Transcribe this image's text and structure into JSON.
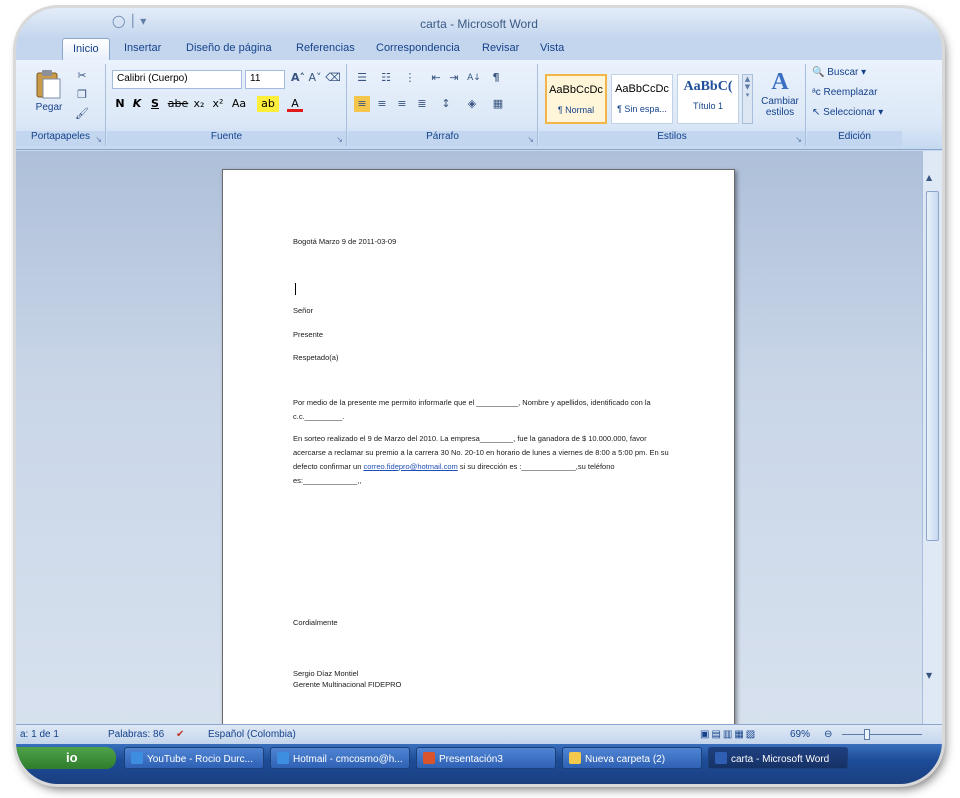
{
  "window": {
    "title": "carta - Microsoft Word",
    "qat_glyph": "◯ │ ▾"
  },
  "tabs": [
    "Inicio",
    "Insertar",
    "Diseño de página",
    "Referencias",
    "Correspondencia",
    "Revisar",
    "Vista"
  ],
  "ribbon": {
    "clipboard": {
      "label": "Portapapeles",
      "paste": "Pegar"
    },
    "font": {
      "label": "Fuente",
      "name": "Calibri (Cuerpo)",
      "size": "11",
      "bold": "N",
      "italic": "K",
      "underline": "S",
      "strike": "abe",
      "subscript": "x₂",
      "superscript": "x²",
      "case": "Aa",
      "grow": "A˄",
      "shrink": "A˅"
    },
    "paragraph": {
      "label": "Párrafo",
      "pilcrow": "¶",
      "sort": "A↓"
    },
    "styles": {
      "label": "Estilos",
      "items": [
        {
          "sample": "AaBbCcDc",
          "name": "¶ Normal"
        },
        {
          "sample": "AaBbCcDc",
          "name": "¶ Sin espa..."
        },
        {
          "sample": "AaBbC(",
          "name": "Título 1"
        }
      ],
      "change": "Cambiar estilos"
    },
    "editing": {
      "label": "Edición",
      "find": "Buscar",
      "replace": "Reemplazar",
      "select": "Seleccionar"
    }
  },
  "document": {
    "date": "Bogotá  Marzo 9 de 2011-03-09",
    "senor": "Señor",
    "presente": "Presente",
    "respetado": "Respetado(a)",
    "p1": "Por medio de la presente me permito informarle que el __________, Nombre y apellidos, identificado  con la  c.c._________.",
    "p2_before": "En sorteo realizado el 9 de Marzo del 2010. La empresa________, fue la ganadora de $ 10.000.000, favor acercarse a reclamar su premio a la carrera 30 No. 20-10 en horario de lunes  a viernes de 8:00 a 5:00 pm. En su defecto confirmar un ",
    "p2_link": "correo.fidepro@hotmail.com",
    "p2_after": "  si su dirección es :_____________,su teléfono es:_____________,,",
    "closing": "Cordialmente",
    "signer": "Sergio Díaz Montiel",
    "signer_title": "Gerente Multinacional  FIDEPRO"
  },
  "status": {
    "page": "a: 1 de 1",
    "words": "Palabras: 86",
    "language": "Español (Colombia)",
    "zoom": "69%"
  },
  "taskbar": {
    "start_partial": "io",
    "items": [
      {
        "label": "YouTube - Rocio Durc...",
        "icon_color": "#3d8ee0"
      },
      {
        "label": "Hotmail - cmcosmo@h...",
        "icon_color": "#3d8ee0"
      },
      {
        "label": "Presentación3",
        "icon_color": "#d9532b"
      },
      {
        "label": "Nueva carpeta (2)",
        "icon_color": "#f2c94c"
      },
      {
        "label": "carta - Microsoft Word",
        "icon_color": "#2f5fb3"
      }
    ]
  }
}
